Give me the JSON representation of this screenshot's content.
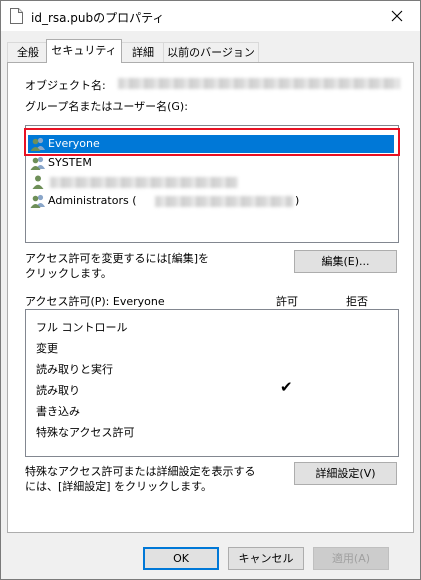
{
  "window": {
    "title": "id_rsa.pubのプロパティ",
    "close_glyph": "✕"
  },
  "tabs": [
    {
      "label": "全般",
      "active": false
    },
    {
      "label": "セキュリティ",
      "active": true
    },
    {
      "label": "詳細",
      "active": false
    },
    {
      "label": "以前のバージョン",
      "active": false
    }
  ],
  "object": {
    "label": "オブジェクト名:"
  },
  "groups": {
    "label": "グループ名またはユーザー名(G):",
    "items": [
      {
        "name": "Everyone",
        "selected": true
      },
      {
        "name": "SYSTEM",
        "selected": false
      },
      {
        "name": "",
        "selected": false
      },
      {
        "name": "Administrators (",
        "suffix": ")",
        "selected": false
      }
    ]
  },
  "edit": {
    "hint_line1": "アクセス許可を変更するには[編集]を",
    "hint_line2": "クリックします。",
    "button_label": "編集(E)..."
  },
  "permissions": {
    "label": "アクセス許可(P): Everyone",
    "allow_header": "許可",
    "deny_header": "拒否",
    "check_glyph": "✔",
    "rows": [
      {
        "name": "フル コントロール",
        "allow": false,
        "deny": false
      },
      {
        "name": "変更",
        "allow": false,
        "deny": false
      },
      {
        "name": "読み取りと実行",
        "allow": false,
        "deny": false
      },
      {
        "name": "読み取り",
        "allow": true,
        "deny": false
      },
      {
        "name": "書き込み",
        "allow": false,
        "deny": false
      },
      {
        "name": "特殊なアクセス許可",
        "allow": false,
        "deny": false
      }
    ]
  },
  "advanced": {
    "hint_line1": "特殊なアクセス許可または詳細設定を表示する",
    "hint_line2": "には、[詳細設定] をクリックします。",
    "button_label": "詳細設定(V)"
  },
  "footer": {
    "ok_label": "OK",
    "cancel_label": "キャンセル",
    "apply_label": "適用(A)"
  },
  "colors": {
    "selection": "#0078d7",
    "highlight_box": "#e81123",
    "default_button_border": "#0078d7"
  }
}
